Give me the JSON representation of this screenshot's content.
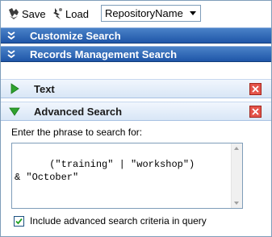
{
  "toolbar": {
    "save_label": "Save",
    "load_label": "Load",
    "repository_select_value": "RepositoryName"
  },
  "collapsed_sections": {
    "customize_search": "Customize Search",
    "records_management_search": "Records Management Search"
  },
  "panels": {
    "text": {
      "title": "Text",
      "expanded": false
    },
    "advanced_search": {
      "title": "Advanced Search",
      "expanded": true,
      "prompt": "Enter the phrase to search for:",
      "query": "(\"training\" | \"workshop\")\n& \"October\"",
      "include_checkbox_label": "Include advanced search criteria in query",
      "include_checked": true
    }
  },
  "colors": {
    "section_bar": "#1f56a8",
    "panel_bar": "#d8e6f6",
    "close_button": "#d9362b",
    "expand_triangle": "#2fa22f"
  },
  "icons": {
    "save": "save-icon",
    "load": "load-icon",
    "section_chevron": "double-chevron-down-icon",
    "collapsed_triangle": "triangle-right-icon",
    "expanded_triangle": "triangle-down-icon",
    "close": "close-icon"
  }
}
